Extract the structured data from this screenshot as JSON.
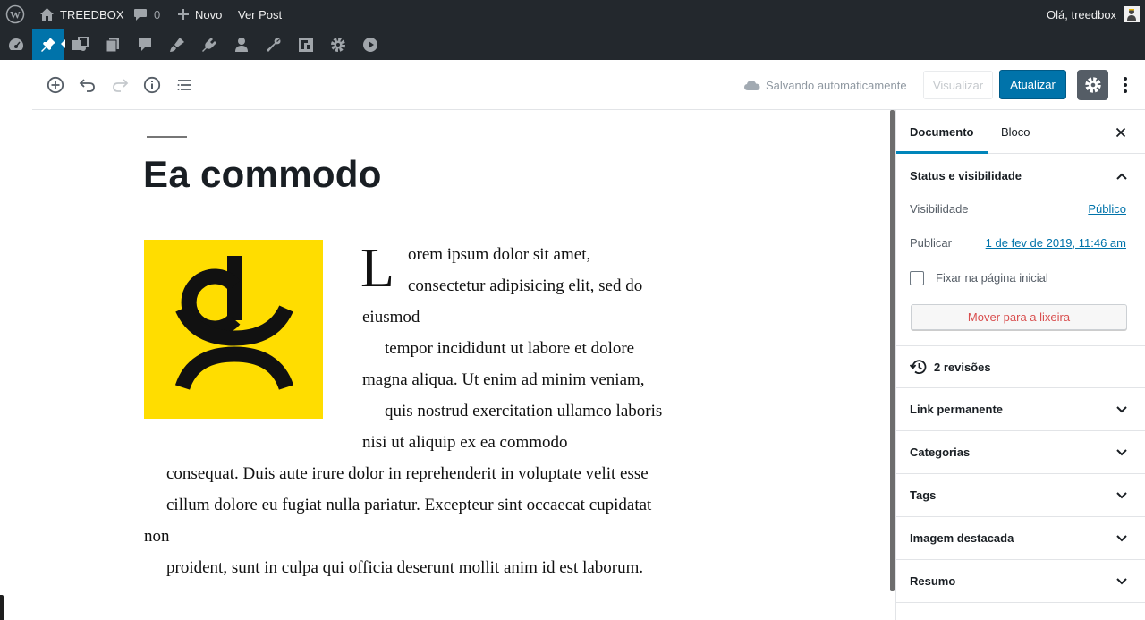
{
  "admin_bar": {
    "site_name": "TREEDBOX",
    "comments_count": "0",
    "new_label": "Novo",
    "view_post_label": "Ver Post",
    "greeting": "Olá, treedbox"
  },
  "admin_menu": {
    "icons": [
      "dashboard-icon",
      "posts-icon",
      "media-icon",
      "pages-icon",
      "comments-icon",
      "appearance-icon",
      "plugins-icon",
      "users-icon",
      "tools-icon",
      "custom-fields-icon",
      "settings-icon",
      "play-icon"
    ],
    "current": "posts-icon"
  },
  "toolbar": {
    "autosave_text": "Salvando automaticamente",
    "preview_label": "Visualizar",
    "update_label": "Atualizar"
  },
  "post": {
    "title": "Ea commodo",
    "drop_cap": "L",
    "lines": [
      "orem ipsum dolor sit amet,",
      "consectetur adipisicing elit, sed do",
      "eiusmod",
      "tempor incididunt ut labore et dolore",
      "magna aliqua. Ut enim ad minim veniam,",
      "quis nostrud exercitation ullamco laboris",
      "nisi ut aliquip ex ea commodo",
      "consequat. Duis aute irure dolor in reprehenderit in voluptate velit esse",
      "cillum dolore eu fugiat nulla pariatur. Excepteur sint occaecat cupidatat",
      "non",
      "proident, sunt in culpa qui officia deserunt mollit anim id est laborum."
    ]
  },
  "sidebar": {
    "tabs": [
      "Documento",
      "Bloco"
    ],
    "active_tab": "Documento",
    "status_panel": {
      "title": "Status e visibilidade",
      "visibility_label": "Visibilidade",
      "visibility_value": "Público",
      "publish_label": "Publicar",
      "publish_value": "1 de fev de 2019, 11:46 am",
      "sticky_label": "Fixar na página inicial",
      "sticky_checked": false,
      "trash_label": "Mover para a lixeira"
    },
    "revisions": "2 revisões",
    "panels": [
      "Link permanente",
      "Categorias",
      "Tags",
      "Imagem destacada",
      "Resumo"
    ]
  },
  "colors": {
    "admin_bar_bg": "#23282d",
    "accent": "#0073aa",
    "image_bg": "#ffdd00",
    "trash_text": "#d94f4f"
  }
}
